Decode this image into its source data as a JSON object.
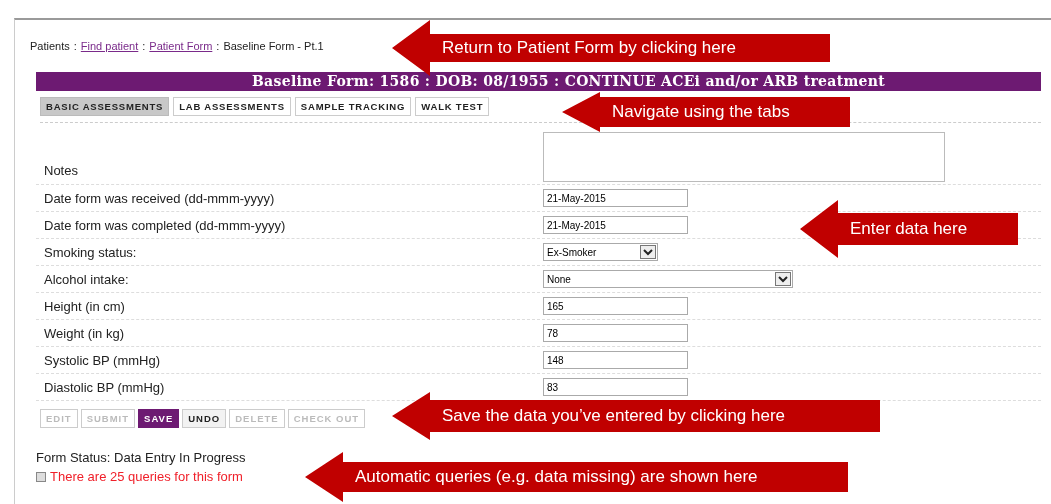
{
  "breadcrumb": [
    {
      "text": "Patients",
      "kind": "text"
    },
    {
      "text": ":",
      "kind": "separator"
    },
    {
      "text": "Find patient",
      "kind": "link"
    },
    {
      "text": ":",
      "kind": "separator"
    },
    {
      "text": "Patient Form",
      "kind": "link"
    },
    {
      "text": ":",
      "kind": "separator"
    },
    {
      "text": "Baseline Form - Pt.1",
      "kind": "text"
    }
  ],
  "form": {
    "title": "Baseline Form: 1586 : DOB: 08/1955 : CONTINUE ACEi and/or ARB treatment",
    "tabs": [
      {
        "label": "BASIC ASSESSMENTS",
        "selected": true
      },
      {
        "label": "LAB ASSESSMENTS",
        "selected": false
      },
      {
        "label": "SAMPLE TRACKING",
        "selected": false
      },
      {
        "label": "WALK TEST",
        "selected": false
      }
    ],
    "fields": [
      {
        "label": "Notes",
        "kind": "textarea"
      },
      {
        "label": "Date form was received (dd-mmm-yyyy)",
        "kind": "text",
        "value": "21-May-2015"
      },
      {
        "label": "Date form was completed (dd-mmm-yyyy)",
        "kind": "text",
        "value": "21-May-2015"
      },
      {
        "label": "Smoking status:",
        "kind": "dropdown",
        "value": "Ex-Smoker"
      },
      {
        "label": "Alcohol intake:",
        "kind": "widedropdown",
        "value": "None"
      },
      {
        "label": "Height (in cm)",
        "kind": "text",
        "value": "165"
      },
      {
        "label": "Weight (in kg)",
        "kind": "text",
        "value": "78"
      },
      {
        "label": "Systolic BP (mmHg)",
        "kind": "text",
        "value": "148"
      },
      {
        "label": "Diastolic BP (mmHg)",
        "kind": "text",
        "value": "83"
      }
    ],
    "buttons": [
      {
        "label": "EDIT",
        "kind": "plain",
        "disabled": true
      },
      {
        "label": "SUBMIT",
        "kind": "plain",
        "disabled": true
      },
      {
        "label": "SAVE",
        "kind": "primary",
        "disabled": false
      },
      {
        "label": "UNDO",
        "kind": "plain",
        "disabled": false
      },
      {
        "label": "DELETE",
        "kind": "plain",
        "disabled": true
      },
      {
        "label": "CHECK OUT",
        "kind": "plain",
        "disabled": true
      }
    ],
    "status": "Form Status: Data Entry In Progress",
    "queries": "There are 25 queries for this form"
  },
  "callouts": [
    "Return to Patient Form by clicking here",
    "Navigate using the tabs",
    "Enter data here",
    "Save the data you’ve entered by clicking here",
    "Automatic queries  (e.g. data missing) are shown here"
  ]
}
